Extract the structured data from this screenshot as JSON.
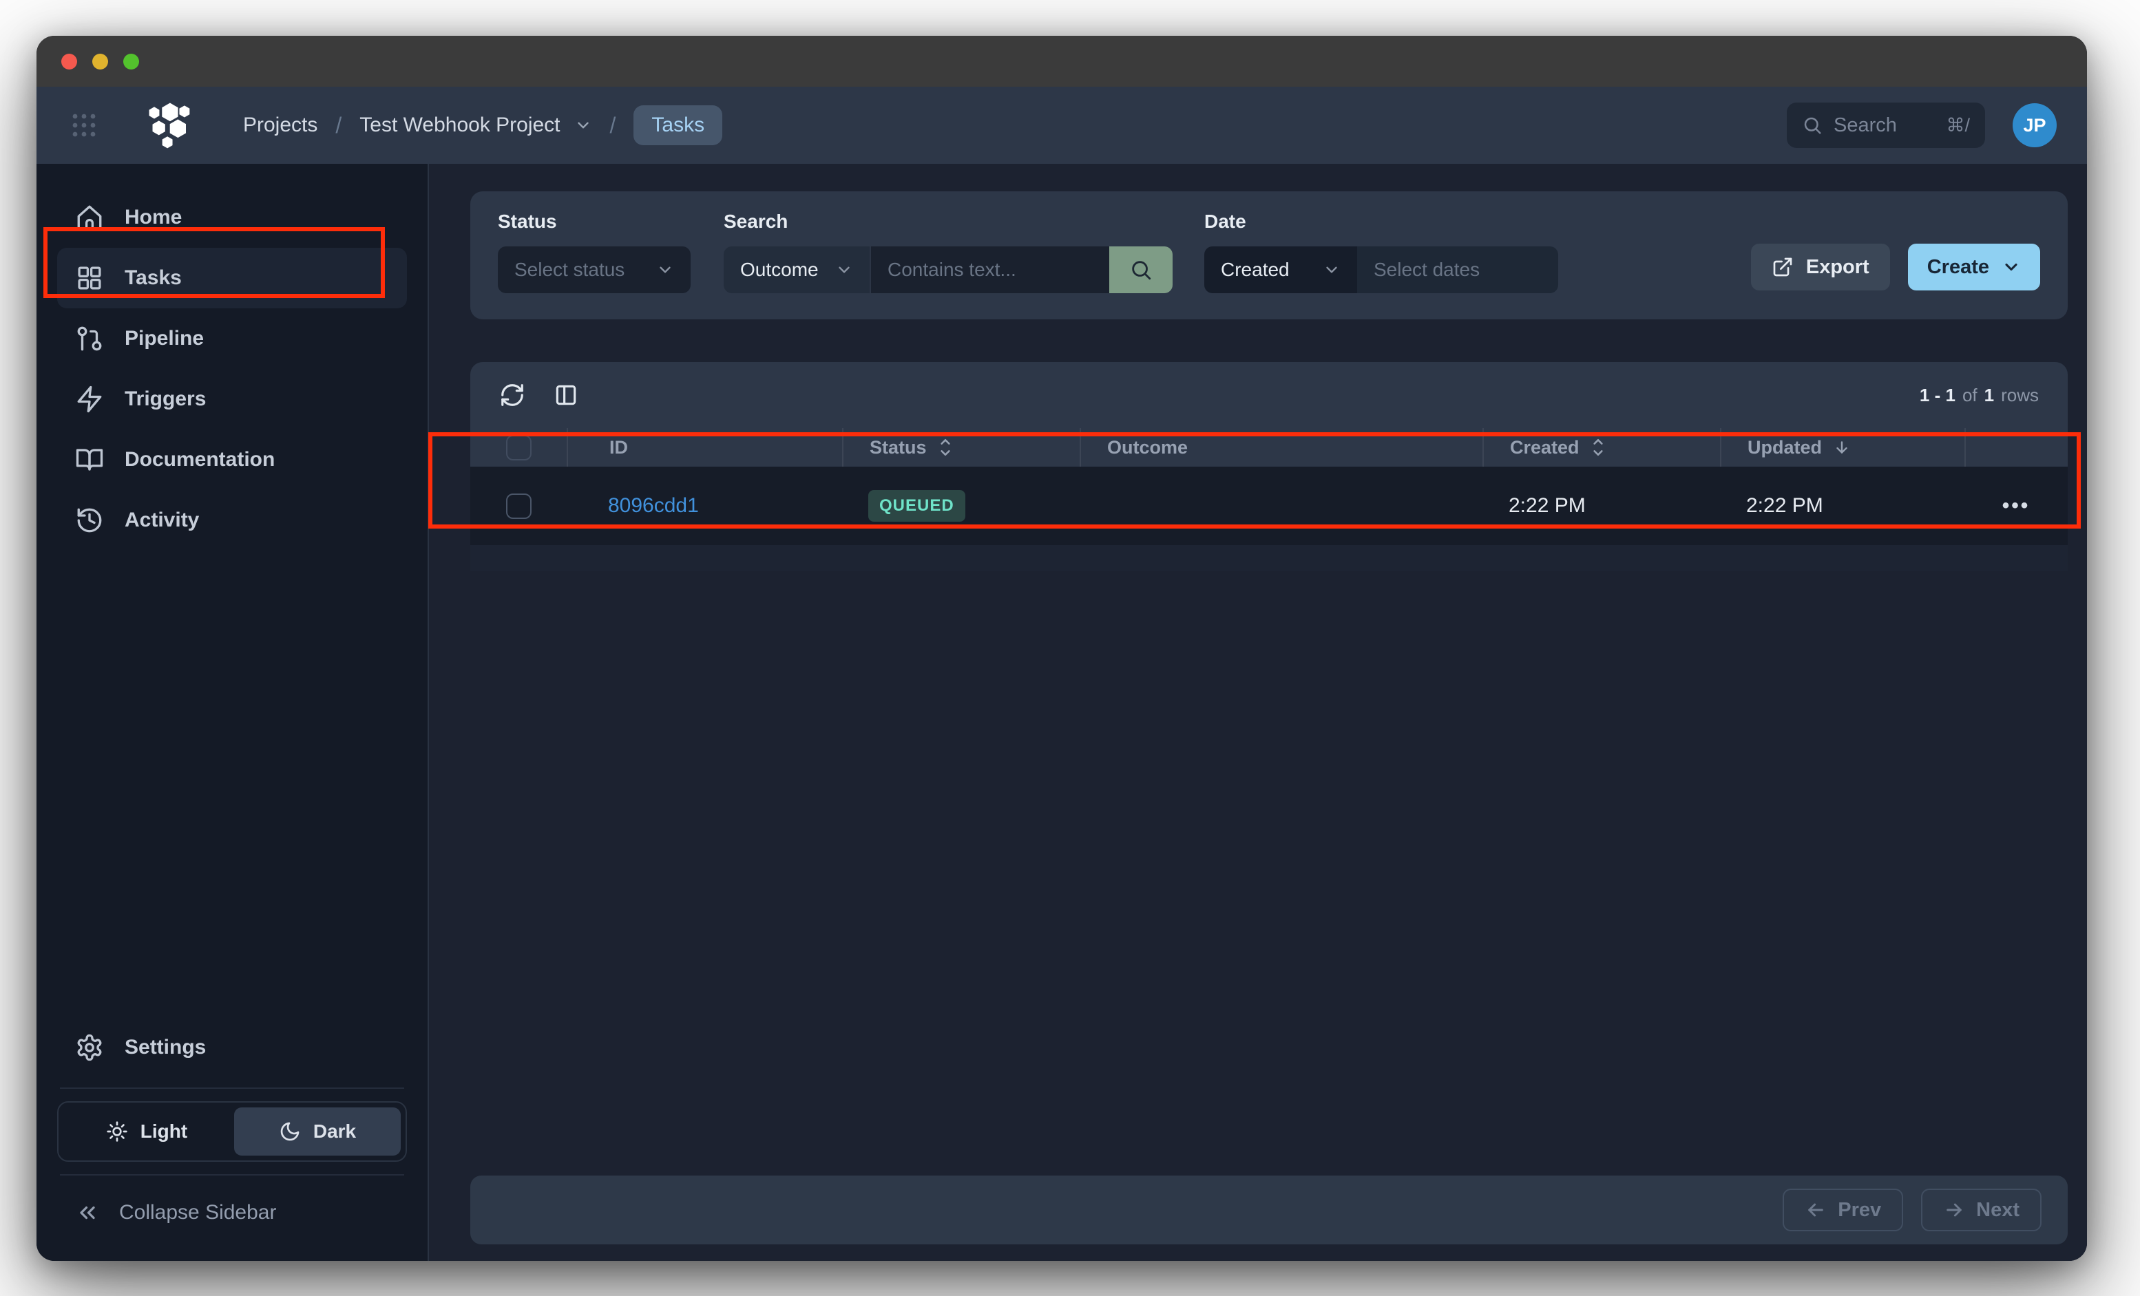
{
  "header": {
    "breadcrumb": {
      "projects": "Projects",
      "separator": "/",
      "project_name": "Test Webhook Project",
      "current_page": "Tasks"
    },
    "search": {
      "placeholder": "Search",
      "shortcut": "⌘/"
    },
    "avatar_initials": "JP"
  },
  "sidebar": {
    "items": [
      {
        "label": "Home",
        "active": false
      },
      {
        "label": "Tasks",
        "active": true
      },
      {
        "label": "Pipeline",
        "active": false
      },
      {
        "label": "Triggers",
        "active": false
      },
      {
        "label": "Documentation",
        "active": false
      },
      {
        "label": "Activity",
        "active": false
      }
    ],
    "settings_label": "Settings",
    "theme_toggle": {
      "light": "Light",
      "dark": "Dark",
      "selected": "Dark"
    },
    "collapse_label": "Collapse Sidebar"
  },
  "filters": {
    "status": {
      "label": "Status",
      "placeholder": "Select status"
    },
    "search": {
      "label": "Search",
      "field_value": "Outcome",
      "placeholder": "Contains text..."
    },
    "date": {
      "label": "Date",
      "field_value": "Created",
      "placeholder": "Select dates"
    },
    "export_label": "Export",
    "create_label": "Create"
  },
  "table": {
    "toolbar": {
      "rows_range": "1 - 1",
      "of_text": "of",
      "rows_total": "1",
      "rows_text": "rows"
    },
    "columns": [
      {
        "label": "ID",
        "sort": null
      },
      {
        "label": "Status",
        "sort": "both"
      },
      {
        "label": "Outcome",
        "sort": null
      },
      {
        "label": "Created",
        "sort": "both"
      },
      {
        "label": "Updated",
        "sort": "desc"
      }
    ],
    "rows": [
      {
        "id": "8096cdd1",
        "status": "QUEUED",
        "outcome": "",
        "created": "2:22 PM",
        "updated": "2:22 PM",
        "actions": "•••"
      }
    ]
  },
  "pagination": {
    "prev_label": "Prev",
    "next_label": "Next"
  },
  "colors": {
    "accent_create_blue": "#8fd0f2",
    "link_blue": "#4191dc",
    "badge_text_teal": "#6fe3c9",
    "badge_bg_teal": "#2c4745",
    "search_button_green": "#7e9c86",
    "annotation_red": "#fd2d0a",
    "avatar_blue": "#2f8bcd",
    "panel_slate": "#2d3748",
    "sidebar_dark": "#141a26",
    "content_dark": "#1c2230",
    "traffic_red": "#f5594e",
    "traffic_yellow": "#e0b32e",
    "traffic_green": "#53c22d"
  }
}
